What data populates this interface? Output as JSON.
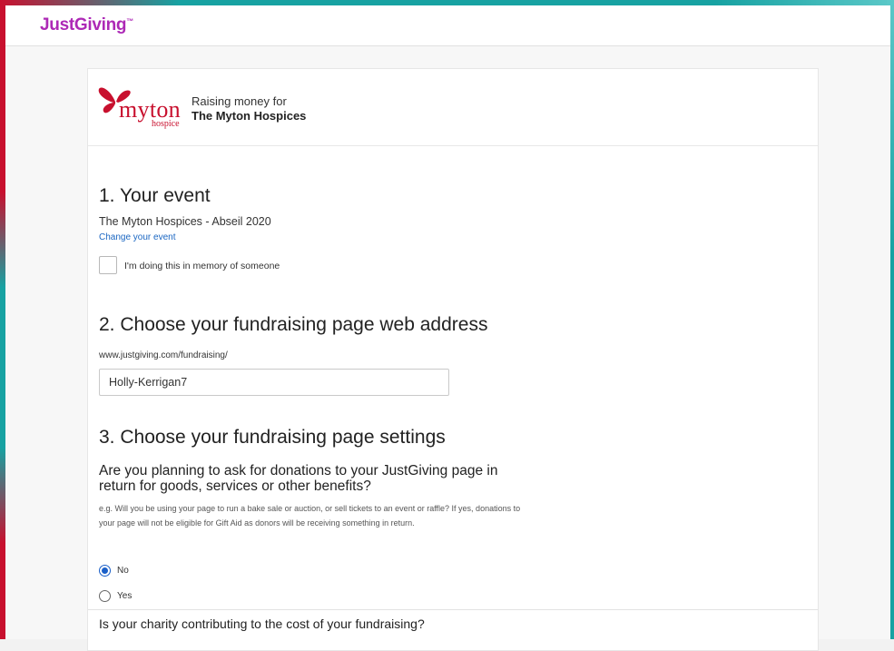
{
  "header": {
    "logo_text": "JustGiving",
    "logo_mark": "™"
  },
  "charity": {
    "logo_word": "myton",
    "logo_sub": "hospice",
    "raising_label": "Raising money for",
    "name": "The Myton Hospices",
    "brand_color": "#c8102e"
  },
  "section1": {
    "heading": "1. Your event",
    "event_name": "The Myton Hospices - Abseil 2020",
    "change_link": "Change your event",
    "memory_checkbox_label": "I'm doing this in memory of someone"
  },
  "section2": {
    "heading": "2. Choose your fundraising page web address",
    "url_prefix": "www.justgiving.com/fundraising/",
    "url_value": "Holly-Kerrigan7"
  },
  "section3": {
    "heading": "3. Choose your fundraising page settings",
    "question": "Are you planning to ask for donations to your JustGiving page in return for goods, services or other benefits?",
    "helper": "e.g. Will you be using your page to run a bake sale or auction, or sell tickets to an event or raffle? If yes, donations to your page will not be eligible for Gift Aid as donors will be receiving something in return.",
    "options": [
      {
        "label": "No",
        "selected": true
      },
      {
        "label": "Yes",
        "selected": false
      }
    ],
    "next_question": "Is your charity contributing to the cost of your fundraising?"
  },
  "colors": {
    "link": "#1a66c2",
    "logo": "#ad29b6",
    "radio_selected": "#1a5fc8"
  }
}
